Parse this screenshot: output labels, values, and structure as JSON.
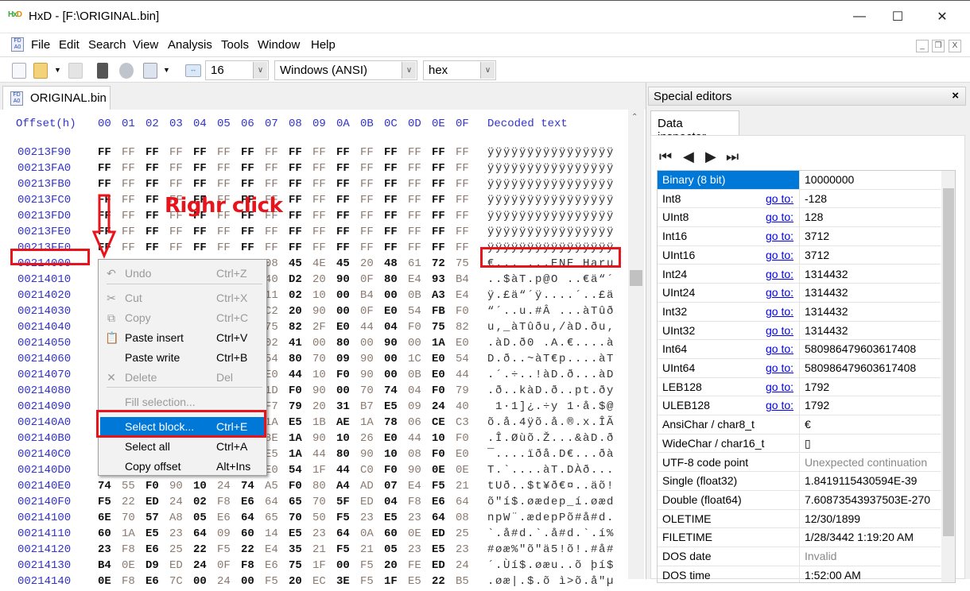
{
  "window": {
    "title": "HxD - [F:\\ORIGINAL.bin]",
    "app_icon_text": "HxD",
    "min": "—",
    "max": "☐",
    "close": "✕"
  },
  "menubar": {
    "items": [
      "File",
      "Edit",
      "Search",
      "View",
      "Analysis",
      "Tools",
      "Window",
      "Help"
    ],
    "mdi_min": "_",
    "mdi_restore": "❐",
    "mdi_close": "X"
  },
  "toolbar": {
    "bytes_per_row": "16",
    "charset": "Windows (ANSI)",
    "offset_base": "hex",
    "dropdown": "∨"
  },
  "tab": {
    "label": "ORIGINAL.bin",
    "icon_text": "FD A0"
  },
  "hex": {
    "header_offset": "Offset(h)",
    "header_cols": [
      "00",
      "01",
      "02",
      "03",
      "04",
      "05",
      "06",
      "07",
      "08",
      "09",
      "0A",
      "0B",
      "0C",
      "0D",
      "0E",
      "0F"
    ],
    "header_decoded": "Decoded text",
    "rows": [
      {
        "offset": "00213F90",
        "bytes": "FF FF FF FF FF FF FF FF FF FF FF FF FF FF FF FF",
        "text": "ÿÿÿÿÿÿÿÿÿÿÿÿÿÿÿÿ"
      },
      {
        "offset": "00213FA0",
        "bytes": "FF FF FF FF FF FF FF FF FF FF FF FF FF FF FF FF",
        "text": "ÿÿÿÿÿÿÿÿÿÿÿÿÿÿÿÿ"
      },
      {
        "offset": "00213FB0",
        "bytes": "FF FF FF FF FF FF FF FF FF FF FF FF FF FF FF FF",
        "text": "ÿÿÿÿÿÿÿÿÿÿÿÿÿÿÿÿ"
      },
      {
        "offset": "00213FC0",
        "bytes": "FF FF FF FF FF FF FF FF FF FF FF FF FF FF FF FF",
        "text": "ÿÿÿÿÿÿÿÿÿÿÿÿÿÿÿÿ"
      },
      {
        "offset": "00213FD0",
        "bytes": "FF FF FF FF FF FF FF FF FF FF FF FF FF FF FF FF",
        "text": "ÿÿÿÿÿÿÿÿÿÿÿÿÿÿÿÿ"
      },
      {
        "offset": "00213FE0",
        "bytes": "FF FF FF FF FF FF FF FF FF FF FF FF FF FF FF FF",
        "text": "ÿÿÿÿÿÿÿÿÿÿÿÿÿÿÿÿ"
      },
      {
        "offset": "00213FF0",
        "bytes": "FF FF FF FF FF FF FF FF FF FF FF FF FF FF FF FF",
        "text": "ÿÿÿÿÿÿÿÿÿÿÿÿÿÿÿÿ"
      },
      {
        "offset": "00214000",
        "bytes": "80 0F 14 00 20 14 10 08 45 4E 45 20 48 61 72 75",
        "text": "€... ...ENE Haru"
      },
      {
        "offset": "00214010",
        "bytes": "10 0F 24 E0 54 0F 70 40 D2 20 90 0F 80 E4 93 B4",
        "text": "..$àT.p@O ..€ä“´"
      },
      {
        "offset": "00214020",
        "bytes": "FF 0B A3 E4 93 B4 FF 11 02 10 00 B4 00 0B A3 E4",
        "text": "ÿ.£ä“´ÿ....´..£ä"
      },
      {
        "offset": "00214030",
        "bytes": "93 B4 00 0F 75 0B 23 C2 20 90 00 0F E0 54 FB F0",
        "text": "“´..u.#Â ...àTûð"
      },
      {
        "offset": "00214040",
        "bytes": "75 82 5F E0 54 FB F0 75 82 2F E0 44 04 F0 75 82",
        "text": "u‚_àTûðu‚/àD.ðu‚"
      },
      {
        "offset": "00214050",
        "bytes": "2C E0 44 04 F0 30 20 02 41 00 80 00 90 00 1A E0",
        "text": ".àD.ð0 .A.€....à"
      },
      {
        "offset": "00214060",
        "bytes": "44 04 F0 00 0B 7E E0 54 80 70 09 90 00 1C E0 54",
        "text": "D.ð..~àT€p....àT"
      },
      {
        "offset": "00214070",
        "bytes": "0F B4 14 F7 00 00 21 E0 44 10 F0 90 00 0B E0 44",
        "text": ".´.÷..!àD.ð...àD"
      },
      {
        "offset": "00214080",
        "bytes": "04 F0 00 0B 6B E0 44 1D F0 90 00 70 74 04 F0 79",
        "text": ".ð..kàD.ð..pt.ðy"
      },
      {
        "offset": "00214090",
        "bytes": "20 31 B7 31 5D BF 1A F7 79 20 31 B7 E5 09 24 40",
        "text": " 1·1]¿.÷y 1·å.$@"
      },
      {
        "offset": "002140A0",
        "bytes": "F5 1A E5 1B 34 FF F5 1A E5 1B AE 1A 78 06 CE C3",
        "text": "õ.å.4ÿõ.å.®.x.ÎÃ"
      },
      {
        "offset": "002140B0",
        "bytes": "1A CE 1A D8 F9 F5 1A 8E 1A 90 10 26 E0 44 10 F0",
        "text": ".Î.Øùõ.Ž...&àD.ð"
      },
      {
        "offset": "002140C0",
        "bytes": "AF 0E 90 00 0E EF F0 E5 1A 44 80 90 10 08 F0 E0",
        "text": "¯....ïðå.D€...ðà"
      },
      {
        "offset": "002140D0",
        "bytes": "54 1F 60 0E 10 90 0E E0 54 1F 44 C0 F0 90 0E 0E",
        "text": "T.`....àT.DÀð..."
      },
      {
        "offset": "002140E0",
        "bytes": "74 55 F0 90 10 24 74 A5 F0 80 A4 AD 07 E4 F5 21",
        "text": "tUð..$t¥ð€¤..äõ!"
      },
      {
        "offset": "002140F0",
        "bytes": "F5 22 ED 24 02 F8 E6 64 65 70 5F ED 04 F8 E6 64",
        "text": "õ\"í$.øædep_í.øæd"
      },
      {
        "offset": "00214100",
        "bytes": "6E 70 57 A8 05 E6 64 65 70 50 F5 23 E5 23 64 08",
        "text": "npW¨.ædepPõ#å#d."
      },
      {
        "offset": "00214110",
        "bytes": "60 1A E5 23 64 09 60 14 E5 23 64 0A 60 0E ED 25",
        "text": "`.å#d.`.å#d.`.í%"
      },
      {
        "offset": "00214120",
        "bytes": "23 F8 E6 25 22 F5 22 E4 35 21 F5 21 05 23 E5 23",
        "text": "#øæ%\"õ\"ä5!õ!.#å#"
      },
      {
        "offset": "00214130",
        "bytes": "B4 0E D9 ED 24 0F F8 E6 75 1F 00 F5 20 FE ED 24",
        "text": "´.Ùí$.øæu..õ þí$"
      },
      {
        "offset": "00214140",
        "bytes": "0E F8 E6 7C 00 24 00 F5 20 EC 3E F5 1F E5 22 B5",
        "text": ".øæ|.$.õ ì>õ.å\"µ"
      }
    ]
  },
  "context_menu": {
    "items": [
      {
        "label": "Undo",
        "shortcut": "Ctrl+Z",
        "disabled": true,
        "icon": "undo-icon",
        "glyph": "↶"
      },
      {
        "label": "Cut",
        "shortcut": "Ctrl+X",
        "disabled": true,
        "icon": "scissors-icon",
        "glyph": "✂"
      },
      {
        "label": "Copy",
        "shortcut": "Ctrl+C",
        "disabled": true,
        "icon": "copy-icon",
        "glyph": "⧉"
      },
      {
        "label": "Paste insert",
        "shortcut": "Ctrl+V",
        "disabled": false,
        "icon": "clipboard-icon",
        "glyph": "📋"
      },
      {
        "label": "Paste write",
        "shortcut": "Ctrl+B",
        "disabled": false
      },
      {
        "label": "Delete",
        "shortcut": "Del",
        "disabled": true,
        "icon": "delete-icon",
        "glyph": "✕"
      },
      {
        "label": "Fill selection...",
        "shortcut": "",
        "disabled": true
      },
      {
        "label": "Select block...",
        "shortcut": "Ctrl+E",
        "disabled": false,
        "highlighted": true
      },
      {
        "label": "Select all",
        "shortcut": "Ctrl+A",
        "disabled": false
      },
      {
        "label": "Copy offset",
        "shortcut": "Alt+Ins",
        "disabled": false
      }
    ]
  },
  "annotation": {
    "text": "Righr click",
    "color": "#e8141c"
  },
  "special_editors": {
    "title": "Special editors",
    "close": "×",
    "tab": "Data inspector",
    "nav": [
      "⏮",
      "◀",
      "▶",
      "⏭"
    ],
    "goto_label": "go to:",
    "rows": [
      {
        "name": "Binary (8 bit)",
        "value": "10000000",
        "goto": false,
        "selected": true
      },
      {
        "name": "Int8",
        "value": "-128",
        "goto": true
      },
      {
        "name": "UInt8",
        "value": "128",
        "goto": true
      },
      {
        "name": "Int16",
        "value": "3712",
        "goto": true
      },
      {
        "name": "UInt16",
        "value": "3712",
        "goto": true
      },
      {
        "name": "Int24",
        "value": "1314432",
        "goto": true
      },
      {
        "name": "UInt24",
        "value": "1314432",
        "goto": true
      },
      {
        "name": "Int32",
        "value": "1314432",
        "goto": true
      },
      {
        "name": "UInt32",
        "value": "1314432",
        "goto": true
      },
      {
        "name": "Int64",
        "value": "580986479603617408",
        "goto": true
      },
      {
        "name": "UInt64",
        "value": "580986479603617408",
        "goto": true
      },
      {
        "name": "LEB128",
        "value": "1792",
        "goto": true
      },
      {
        "name": "ULEB128",
        "value": "1792",
        "goto": true
      },
      {
        "name": "AnsiChar / char8_t",
        "value": "€",
        "goto": false
      },
      {
        "name": "WideChar / char16_t",
        "value": "▯",
        "goto": false
      },
      {
        "name": "UTF-8 code point",
        "value": "Unexpected continuation",
        "goto": false,
        "muted": true
      },
      {
        "name": "Single (float32)",
        "value": "1.8419115430594E-39",
        "goto": false
      },
      {
        "name": "Double (float64)",
        "value": "7.60873543937503E-270",
        "goto": false
      },
      {
        "name": "OLETIME",
        "value": "12/30/1899",
        "goto": false
      },
      {
        "name": "FILETIME",
        "value": "1/28/3442 1:19:20 AM",
        "goto": false
      },
      {
        "name": "DOS date",
        "value": "Invalid",
        "goto": false,
        "muted": true
      },
      {
        "name": "DOS time",
        "value": "1:52:00 AM",
        "goto": false
      }
    ]
  }
}
